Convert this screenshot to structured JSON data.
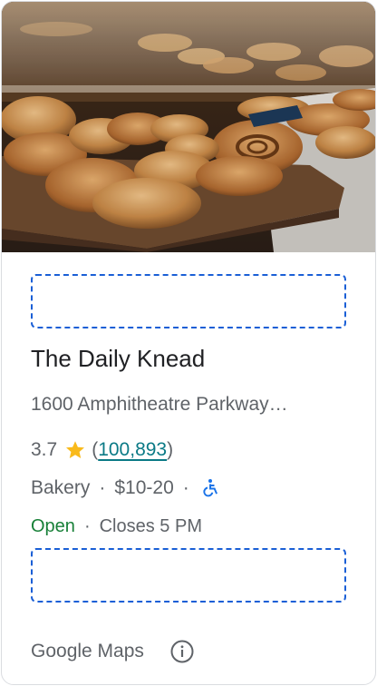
{
  "place": {
    "name": "The Daily Knead",
    "address": "1600 Amphitheatre Parkway…",
    "rating": "3.7",
    "review_count_open": "(",
    "review_count": "100,893",
    "review_count_close": ")",
    "category": "Bakery",
    "price": "$10-20",
    "separator": "·",
    "open_status": "Open",
    "closing": "Closes 5 PM"
  },
  "footer": {
    "attribution": "Google Maps"
  },
  "colors": {
    "star": "#f9ba1b",
    "review_link": "#0b7a86",
    "open": "#188038",
    "accessibility_icon": "#1a73e8",
    "placeholder_border": "#1a5fd6"
  },
  "icons": [
    "star-icon",
    "wheelchair-accessible-icon",
    "info-icon"
  ]
}
